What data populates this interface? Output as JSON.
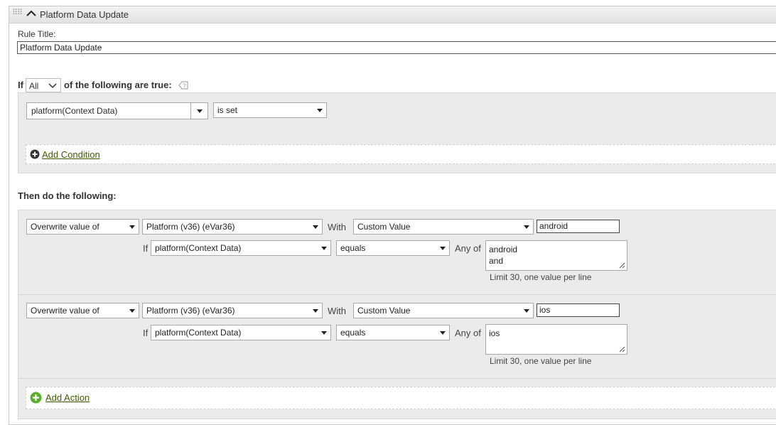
{
  "header": {
    "title": "Platform Data Update"
  },
  "rule": {
    "title_label": "Rule Title:",
    "title_value": "Platform Data Update"
  },
  "criteria": {
    "prefix": "If",
    "match": "All",
    "suffix": "of the following are true:"
  },
  "condition": {
    "field": "platform(Context Data)",
    "operator": "is set"
  },
  "add_condition_label": "Add Condition",
  "then_label": "Then do the following:",
  "actions": [
    {
      "action": "Overwrite value of",
      "variable": "Platform (v36) (eVar36)",
      "with_label": "With",
      "value_type": "Custom Value",
      "value": "android",
      "if_label": "If",
      "if_field": "platform(Context Data)",
      "if_operator": "equals",
      "any_of_label": "Any of",
      "values_text": "android\nand",
      "hint": "Limit 30, one value per line"
    },
    {
      "action": "Overwrite value of",
      "variable": "Platform (v36) (eVar36)",
      "with_label": "With",
      "value_type": "Custom Value",
      "value": "ios",
      "if_label": "If",
      "if_field": "platform(Context Data)",
      "if_operator": "equals",
      "any_of_label": "Any of",
      "values_text": "ios",
      "hint": "Limit 30, one value per line"
    }
  ],
  "add_action_label": "Add Action",
  "icons": {
    "grip": "drag-grip-icon",
    "collapse": "chevron-up-icon",
    "help": "help-icon",
    "add_condition": "plus-circle-icon",
    "add_action": "plus-circle-icon"
  },
  "colors": {
    "link": "#3e5c00",
    "add_action_icon": "#5aaf2a",
    "panel_bg": "#ebebeb"
  }
}
